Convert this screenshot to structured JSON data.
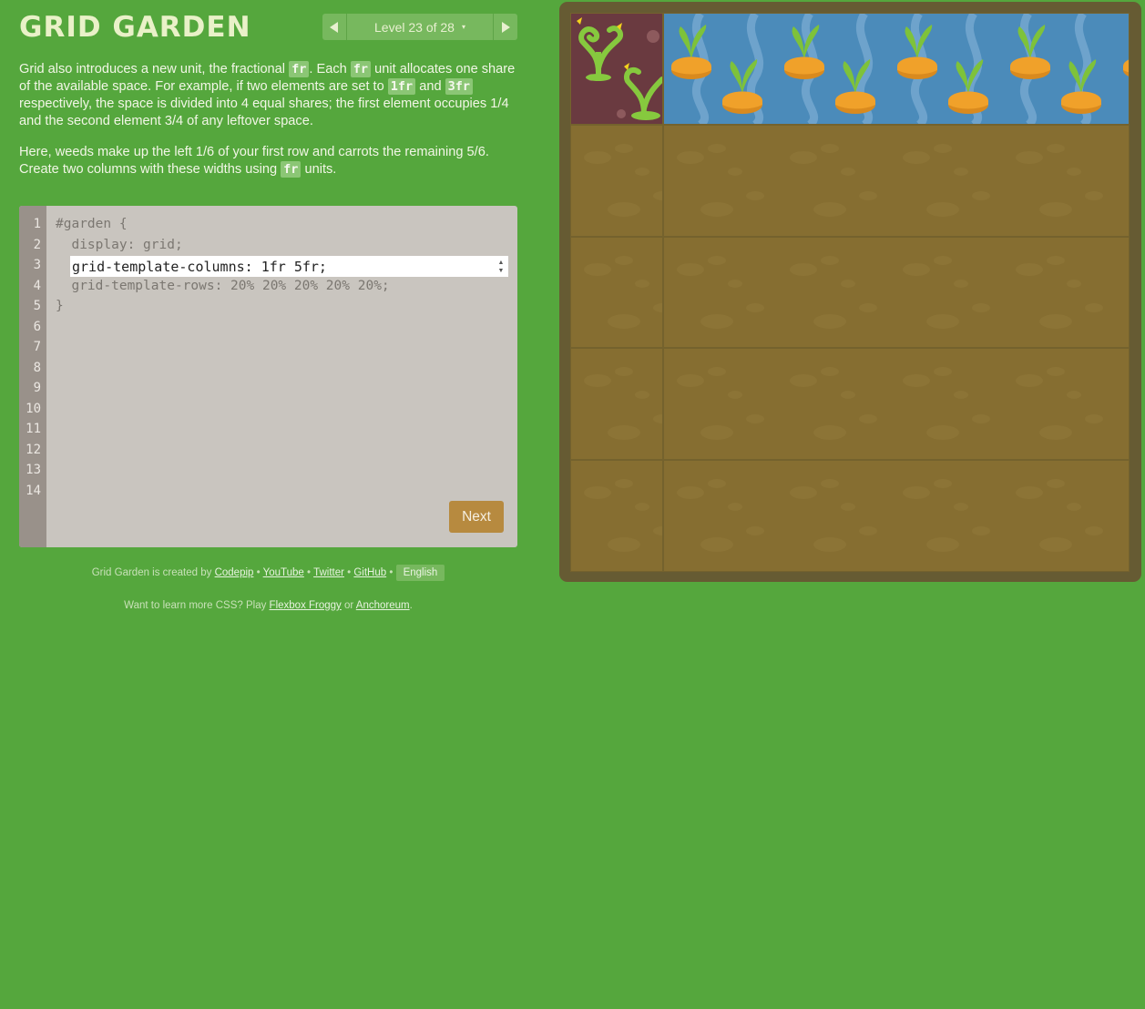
{
  "app": {
    "title": "GRID GARDEN"
  },
  "level_nav": {
    "prev_icon": "triangle-left-icon",
    "next_icon": "triangle-right-icon",
    "label": "Level 23 of 28",
    "caret": "▾"
  },
  "instructions": {
    "p1": {
      "t1": "Grid also introduces a new unit, the fractional ",
      "c1": "fr",
      "t2": ". Each ",
      "c2": "fr",
      "t3": " unit allocates one share of the available space. For example, if two elements are set to ",
      "c3": "1fr",
      "t4": " and ",
      "c4": "3fr",
      "t5": " respectively, the space is divided into 4 equal shares; the first element occupies 1/4 and the second element 3/4 of any leftover space."
    },
    "p2": {
      "t1": "Here, weeds make up the left 1/6 of your first row and carrots the remaining 5/6. Create two columns with these widths using ",
      "c1": "fr",
      "t2": " units."
    }
  },
  "editor": {
    "line_numbers": [
      "1",
      "2",
      "3",
      "4",
      "5",
      "6",
      "7",
      "8",
      "9",
      "10",
      "11",
      "12",
      "13",
      "14"
    ],
    "line1": "#garden {",
    "line2": "  display: grid;",
    "input_value": "grid-template-columns: 1fr 5fr;",
    "line4": "  grid-template-rows: 20% 20% 20% 20% 20%;",
    "line5": "}",
    "next_label": "Next"
  },
  "footer": {
    "credit_prefix": "Grid Garden is created by ",
    "links": [
      "Codepip",
      "YouTube",
      "Twitter",
      "GitHub"
    ],
    "separator": " • ",
    "language": "English",
    "more_prefix": "Want to learn more CSS? Play ",
    "more_link1": "Flexbox Froggy",
    "more_or": " or ",
    "more_link2": "Anchoreum",
    "more_suffix": "."
  },
  "colors": {
    "background": "#55a73d",
    "soil": "#866e31",
    "frame": "#665b33",
    "water": "#4b8bba",
    "weed_bg": "#6a3a40",
    "carrot": "#f0a12a",
    "leaf": "#7ec23a",
    "next_button": "#b78a3f"
  }
}
